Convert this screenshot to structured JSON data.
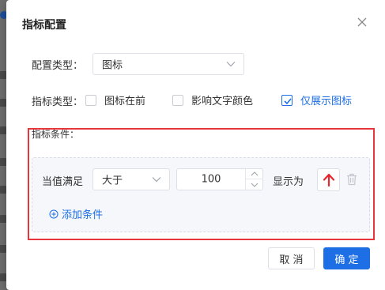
{
  "dialog": {
    "title": "指标配置"
  },
  "config_type": {
    "label": "配置类型：",
    "value": "图标"
  },
  "indicator_type": {
    "label": "指标类型：",
    "options": [
      {
        "label": "图标在前",
        "checked": false
      },
      {
        "label": "影响文字颜色",
        "checked": false
      },
      {
        "label": "仅展示图标",
        "checked": true
      }
    ]
  },
  "conditions": {
    "label": "指标条件：",
    "rule": {
      "when_label": "当值满足",
      "operator": "大于",
      "value": "100",
      "display_label": "显示为",
      "icon": "red-up-arrow-icon"
    },
    "add_label": "添加条件"
  },
  "footer": {
    "cancel_label": "取 消",
    "ok_label": "确 定"
  },
  "colors": {
    "primary": "#1e6fe6",
    "highlight_frame": "#e8363d",
    "arrow": "#e8262d"
  }
}
